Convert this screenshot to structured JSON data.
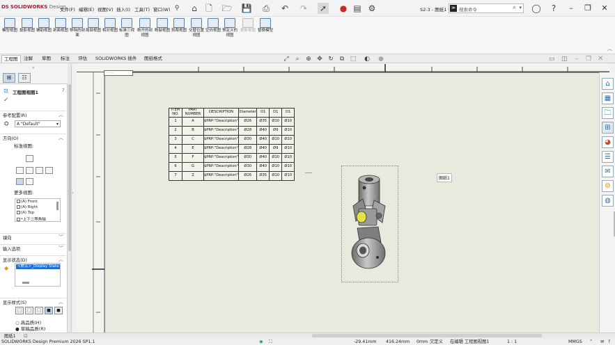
{
  "titlebar": {
    "app_logo_ds": "DS",
    "app_logo_text": "SOLIDWORKS",
    "app_logo_suffix": "Design",
    "menus": [
      "文件(F)",
      "编辑(E)",
      "视图(V)",
      "插入(I)",
      "工具(T)",
      "窗口(W)"
    ],
    "document_title": "S2-3 - 图纸1 *",
    "search_placeholder": "搜索命令",
    "search_icon_text": "≫"
  },
  "ribbon": {
    "buttons": [
      {
        "label": "模型视图",
        "disabled": false
      },
      {
        "label": "投影视图",
        "disabled": false
      },
      {
        "label": "辅助视图",
        "disabled": false
      },
      {
        "label": "剖面视图",
        "disabled": false
      },
      {
        "label": "移除的剖面",
        "disabled": false
      },
      {
        "label": "局部视图",
        "disabled": false
      },
      {
        "label": "相对视图",
        "disabled": false
      },
      {
        "label": "标准三视图",
        "disabled": false
      },
      {
        "label": "断开的剖视图",
        "disabled": false
      },
      {
        "label": "断裂视图",
        "disabled": false
      },
      {
        "label": "剪裁视图",
        "disabled": false
      },
      {
        "label": "交替位置视图",
        "disabled": false
      },
      {
        "label": "空白视图",
        "disabled": false
      },
      {
        "label": "预定义的视图",
        "disabled": false
      },
      {
        "label": "更新视图",
        "disabled": true
      },
      {
        "label": "替换模型",
        "disabled": false
      }
    ]
  },
  "tabs": [
    "工程图",
    "注解",
    "草图",
    "标注",
    "评估",
    "SOLIDWORKS 插件",
    "图纸格式"
  ],
  "active_tab": 0,
  "property_manager": {
    "title": "工程图视图1",
    "sections": {
      "ref_config": "参考配置(R)",
      "config_value": "A \"Default\"",
      "orientation": "方向(O)",
      "standard_views": "标准视图:",
      "more_views": "更多视图:",
      "more_views_items": [
        "(A) Front",
        "(A) Right",
        "(A) Top",
        "*上下二等角轴"
      ],
      "mirror": "镜向",
      "import_options": "输入选项",
      "display_state": "显示状态(D)",
      "display_state_item": "<默认>_Display State 1",
      "display_style": "显示样式(S)",
      "hq": "高品质(H)",
      "draft": "草稿品质(R)"
    }
  },
  "bom": {
    "headers": [
      "ITEM NO.",
      "PART NUMBER",
      "DESCRIPTION",
      "Diameter",
      "D1",
      "D1",
      "D1"
    ],
    "rows": [
      [
        "1",
        "A",
        "$PRP:\"Description\"",
        "Ø26",
        "Ø35",
        "Ø10",
        "Ø10"
      ],
      [
        "2",
        "B",
        "$PRP:\"Description\"",
        "Ø28",
        "Ø40",
        "Ø9",
        "Ø10"
      ],
      [
        "3",
        "C",
        "$PRP:\"Description\"",
        "Ø30",
        "Ø40",
        "Ø10",
        "Ø10"
      ],
      [
        "4",
        "E",
        "$PRP:\"Description\"",
        "Ø28",
        "Ø40",
        "Ø9",
        "Ø10"
      ],
      [
        "5",
        "F",
        "$PRP:\"Description\"",
        "Ø30",
        "Ø40",
        "Ø10",
        "Ø10"
      ],
      [
        "6",
        "G",
        "$PRP:\"Description\"",
        "Ø30",
        "Ø40",
        "Ø10",
        "Ø10"
      ],
      [
        "7",
        "Z",
        "$PRP:\"Description\"",
        "Ø26",
        "Ø35",
        "Ø10",
        "Ø10"
      ]
    ]
  },
  "sheet_label": "图纸1",
  "sheet_tab": "图纸1",
  "statusbar": {
    "product": "SOLIDWORKS Design Premium 2026 SP1.1",
    "x": "-29.41mm",
    "y": "416.24mm",
    "z": "0mm",
    "state": "欠定义",
    "editing": "在编辑 工程图视图1",
    "scale": "1 : 1",
    "units": "MMGS"
  },
  "colors": {
    "accent": "#1e6fd0",
    "sheet": "#e9e9dd",
    "part": "#9a9a9a",
    "part_highlight": "#e5e24a"
  }
}
